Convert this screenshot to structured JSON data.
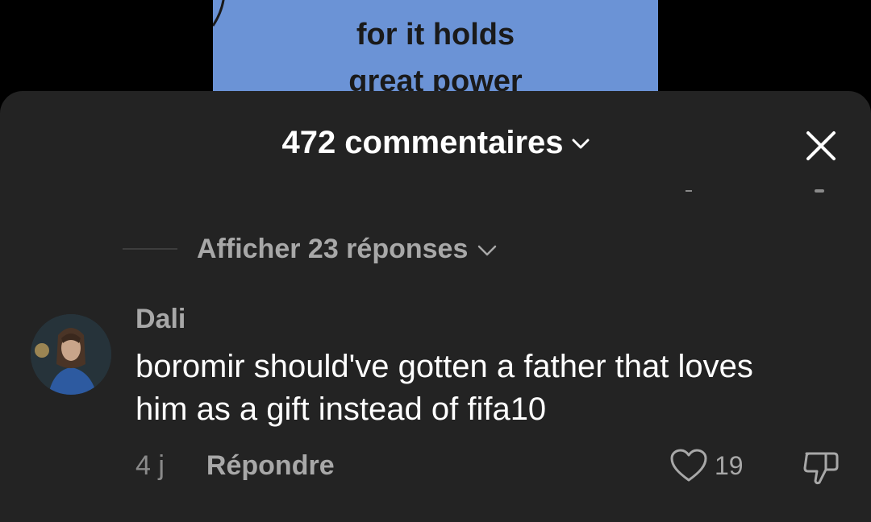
{
  "video": {
    "caption_line1": "for it holds",
    "caption_line2": "great power",
    "background_color": "#6b93d6"
  },
  "sheet": {
    "comment_count_label": "472 commentaires",
    "close_icon": "close-icon",
    "background_color": "#232323"
  },
  "replies": {
    "label": "Afficher 23 réponses"
  },
  "comment": {
    "username": "Dali",
    "line1": "boromir should've gotten a father that loves",
    "line2": "him as a gift instead of fifa10",
    "time": "4 j",
    "reply_label": "Répondre",
    "like_count": "19",
    "like_icon": "heart-icon",
    "dislike_icon": "thumbs-down-icon"
  }
}
